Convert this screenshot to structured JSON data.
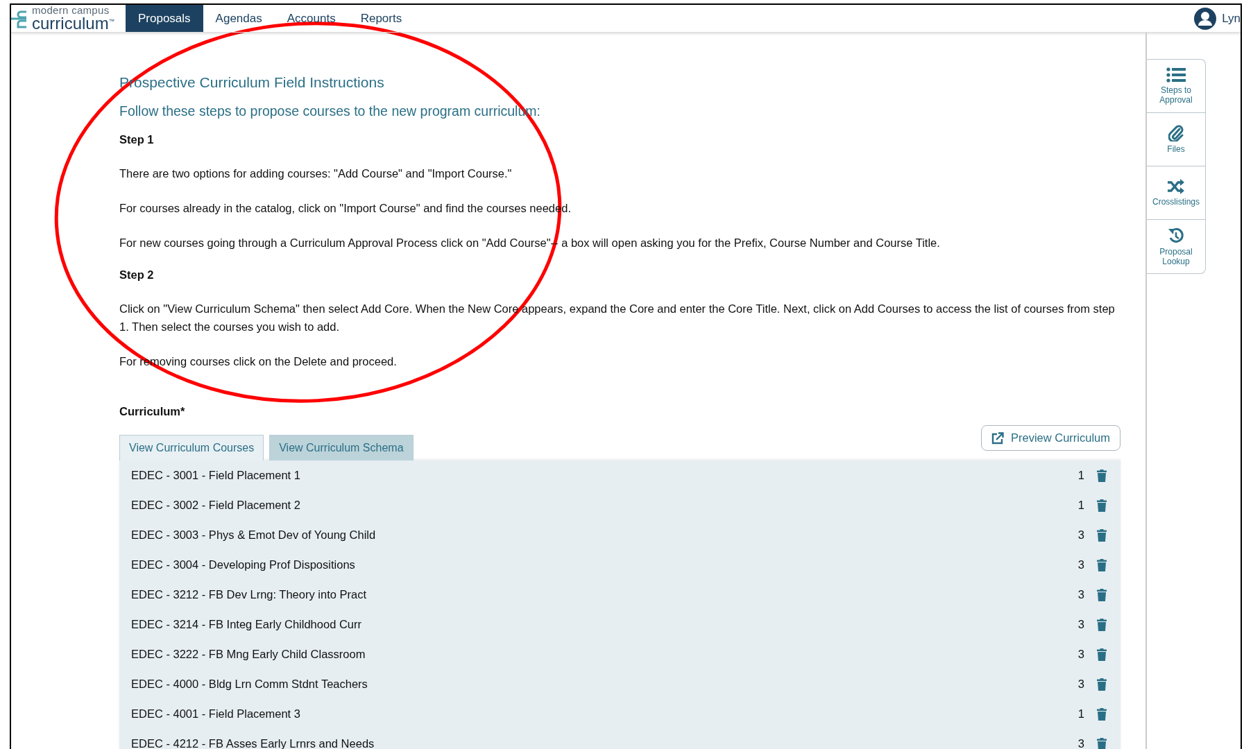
{
  "header": {
    "logo_top": "modern campus",
    "logo_bottom": "curriculum",
    "logo_mark": "™",
    "nav": [
      {
        "label": "Proposals",
        "selected": true
      },
      {
        "label": "Agendas",
        "selected": false
      },
      {
        "label": "Accounts",
        "selected": false
      },
      {
        "label": "Reports",
        "selected": false
      }
    ],
    "user": "Lyn"
  },
  "instructions": {
    "title": "Prospective Curriculum Field Instructions",
    "subtitle": "Follow these steps to propose courses to the new program curriculum:",
    "blocks": [
      {
        "kind": "heading",
        "text": "Step 1"
      },
      {
        "kind": "para",
        "text": "There are two options for adding courses: \"Add Course\" and \"Import Course.\""
      },
      {
        "kind": "para",
        "text": "For courses already in the catalog, click on \"Import Course\" and find the courses needed."
      },
      {
        "kind": "para",
        "text": "For new courses going through a Curriculum Approval Process click on \"Add Course\"-- a box will open asking you for the Prefix, Course Number and Course Title."
      },
      {
        "kind": "heading",
        "text": "Step 2"
      },
      {
        "kind": "para",
        "text": "Click on \"View Curriculum Schema\" then select Add Core. When the New Core appears, expand the Core and enter the Core Title. Next, click on Add Courses to access the list of courses from step 1. Then select the courses you wish to add."
      },
      {
        "kind": "para",
        "text": "For removing courses click on the Delete and proceed."
      }
    ]
  },
  "curriculum": {
    "label": "Curriculum*",
    "tabs": [
      {
        "label": "View Curriculum Courses",
        "selected": true
      },
      {
        "label": "View Curriculum Schema",
        "selected": false
      }
    ],
    "preview_button": "Preview Curriculum",
    "rows": [
      {
        "course": "EDEC - 3001 - Field Placement 1",
        "credits": "1"
      },
      {
        "course": "EDEC - 3002 - Field Placement 2",
        "credits": "1"
      },
      {
        "course": "EDEC - 3003 - Phys & Emot Dev of Young Child",
        "credits": "3"
      },
      {
        "course": "EDEC - 3004 - Developing Prof Dispositions",
        "credits": "3"
      },
      {
        "course": "EDEC - 3212 - FB Dev Lrng: Theory into Pract",
        "credits": "3"
      },
      {
        "course": "EDEC - 3214 - FB Integ Early Childhood Curr",
        "credits": "3"
      },
      {
        "course": "EDEC - 3222 - FB Mng Early Child Classroom",
        "credits": "3"
      },
      {
        "course": "EDEC - 4000 - Bldg Lrn Comm Stdnt Teachers",
        "credits": "3"
      },
      {
        "course": "EDEC - 4001 - Field Placement 3",
        "credits": "1"
      },
      {
        "course": "EDEC - 4212 - FB Asses Early Lrnrs and Needs",
        "credits": "3"
      }
    ]
  },
  "rail": [
    {
      "kind": "list",
      "label": "Steps to Approval"
    },
    {
      "kind": "clip",
      "label": "Files"
    },
    {
      "kind": "shuffle",
      "label": "Crosslistings"
    },
    {
      "kind": "history",
      "label": "Proposal Lookup"
    }
  ]
}
